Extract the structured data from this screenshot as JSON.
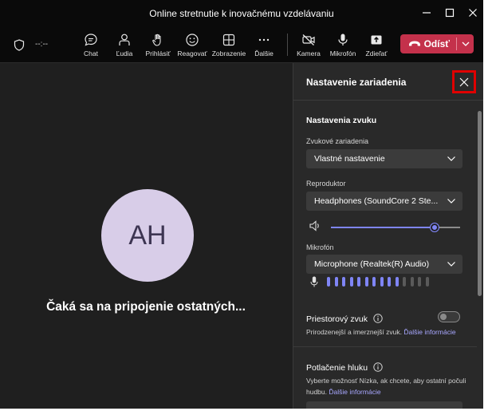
{
  "window": {
    "title": "Online stretnutie k inovačnému vzdelávaniu",
    "controls": [
      "minimize-icon",
      "maximize-icon",
      "close-icon"
    ]
  },
  "toolbar": {
    "timer": "--:--",
    "buttons": [
      {
        "label": "Chat",
        "icon": "chat-icon"
      },
      {
        "label": "Ľudia",
        "icon": "people-icon"
      },
      {
        "label": "Prihlásiť",
        "icon": "raise-hand-icon"
      },
      {
        "label": "Reagovať",
        "icon": "smiley-icon"
      },
      {
        "label": "Zobrazenie",
        "icon": "layout-icon"
      },
      {
        "label": "Ďalšie",
        "icon": "more-icon"
      },
      {
        "label": "Kamera",
        "icon": "camera-off-icon"
      },
      {
        "label": "Mikrofón",
        "icon": "microphone-icon"
      },
      {
        "label": "Zdieľať",
        "icon": "share-icon"
      }
    ],
    "leave_label": "Odísť"
  },
  "stage": {
    "avatar_initials": "AH",
    "waiting_text": "Čaká sa na pripojenie ostatných..."
  },
  "panel": {
    "title": "Nastavenie zariadenia",
    "audio_section": "Nastavenia zvuku",
    "audio_devices_label": "Zvukové zariadenia",
    "audio_devices_value": "Vlastné nastavenie",
    "speaker_label": "Reproduktor",
    "speaker_value": "Headphones (SoundCore 2 Ste...",
    "speaker_volume": 0.8,
    "mic_label": "Mikrofón",
    "mic_value": "Microphone (Realtek(R) Audio)",
    "mic_level_bars_total": 14,
    "mic_level_bars_active": 10,
    "spatial_label": "Priestorový zvuk",
    "spatial_on": false,
    "spatial_desc": "Prirodzenejší a imerznejší zvuk.",
    "spatial_link": "Ďalšie informácie",
    "noise_label": "Potlačenie hluku",
    "noise_desc": "Vyberte možnosť Nízka, ak chcete, aby ostatní počuli hudbu.",
    "noise_link": "Ďalšie informácie"
  },
  "colors": {
    "accent": "#7f85f5",
    "leave": "#c4314b",
    "highlight": "#e00000"
  }
}
